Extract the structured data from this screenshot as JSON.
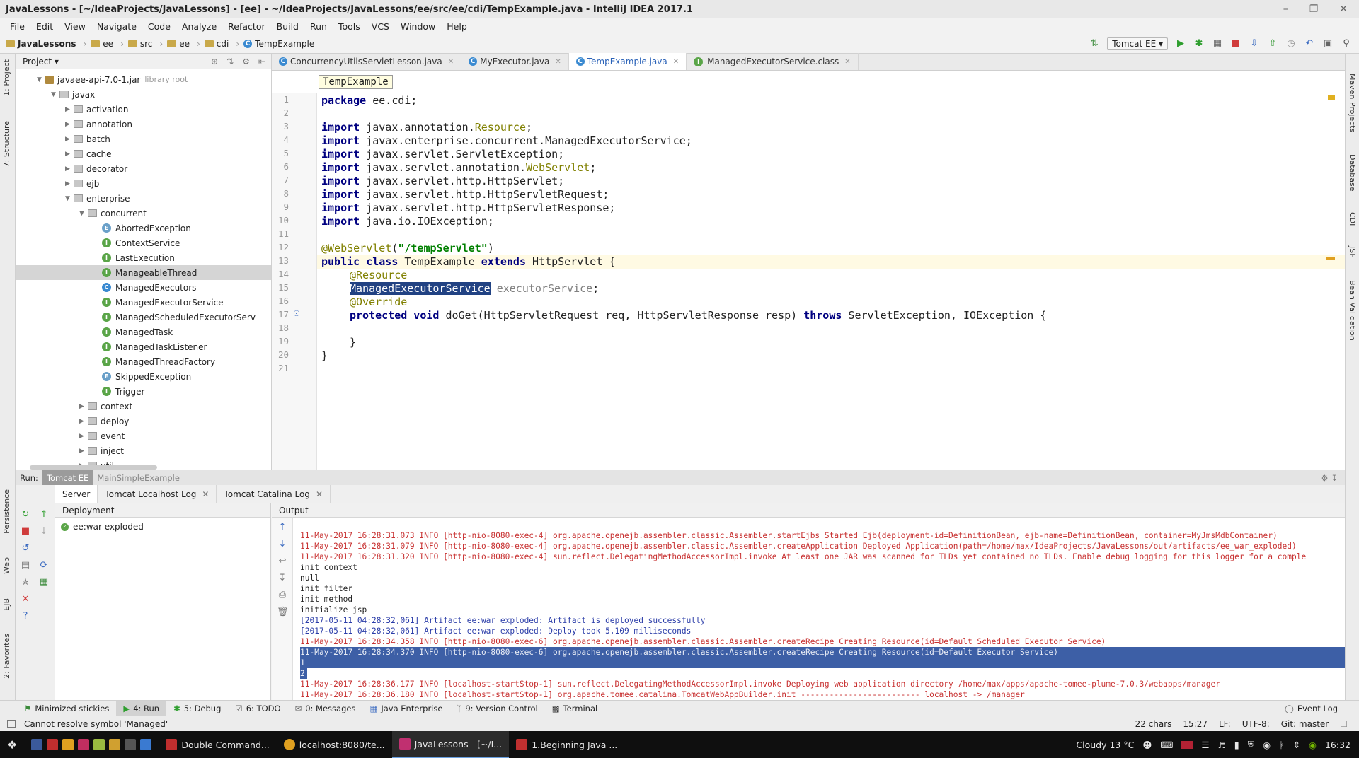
{
  "window": {
    "title": "JavaLessons - [~/IdeaProjects/JavaLessons] - [ee] - ~/IdeaProjects/JavaLessons/ee/src/ee/cdi/TempExample.java - IntelliJ IDEA 2017.1"
  },
  "menu": [
    "File",
    "Edit",
    "View",
    "Navigate",
    "Code",
    "Analyze",
    "Refactor",
    "Build",
    "Run",
    "Tools",
    "VCS",
    "Window",
    "Help"
  ],
  "breadcrumb": [
    "JavaLessons",
    "ee",
    "src",
    "ee",
    "cdi",
    "TempExample"
  ],
  "run_config": "Tomcat EE",
  "project_panel": {
    "title": "Project",
    "tree": [
      {
        "label": "javaee-api-7.0-1.jar",
        "note": "library root",
        "kind": "jar"
      },
      {
        "label": "javax",
        "kind": "pkg"
      },
      {
        "label": "activation",
        "kind": "pkg"
      },
      {
        "label": "annotation",
        "kind": "pkg"
      },
      {
        "label": "batch",
        "kind": "pkg"
      },
      {
        "label": "cache",
        "kind": "pkg"
      },
      {
        "label": "decorator",
        "kind": "pkg"
      },
      {
        "label": "ejb",
        "kind": "pkg"
      },
      {
        "label": "enterprise",
        "kind": "pkg"
      },
      {
        "label": "concurrent",
        "kind": "pkg"
      },
      {
        "label": "AbortedException",
        "kind": "ex"
      },
      {
        "label": "ContextService",
        "kind": "iface"
      },
      {
        "label": "LastExecution",
        "kind": "iface"
      },
      {
        "label": "ManageableThread",
        "kind": "iface"
      },
      {
        "label": "ManagedExecutors",
        "kind": "class"
      },
      {
        "label": "ManagedExecutorService",
        "kind": "iface"
      },
      {
        "label": "ManagedScheduledExecutorServ",
        "kind": "iface"
      },
      {
        "label": "ManagedTask",
        "kind": "iface"
      },
      {
        "label": "ManagedTaskListener",
        "kind": "iface"
      },
      {
        "label": "ManagedThreadFactory",
        "kind": "iface"
      },
      {
        "label": "SkippedException",
        "kind": "ex"
      },
      {
        "label": "Trigger",
        "kind": "iface"
      },
      {
        "label": "context",
        "kind": "pkg"
      },
      {
        "label": "deploy",
        "kind": "pkg"
      },
      {
        "label": "event",
        "kind": "pkg"
      },
      {
        "label": "inject",
        "kind": "pkg"
      },
      {
        "label": "util",
        "kind": "pkg"
      }
    ]
  },
  "editor": {
    "tabs": [
      {
        "label": "ConcurrencyUtilsServletLesson.java",
        "active": false
      },
      {
        "label": "MyExecutor.java",
        "active": false
      },
      {
        "label": "TempExample.java",
        "active": true
      },
      {
        "label": "ManagedExecutorService.class",
        "active": false
      }
    ],
    "crumb_popup": "TempExample",
    "line_numbers": [
      "1",
      "2",
      "3",
      "4",
      "5",
      "6",
      "7",
      "8",
      "9",
      "10",
      "11",
      "12",
      "13",
      "14",
      "15",
      "16",
      "17",
      "18",
      "19",
      "20",
      "21"
    ],
    "code": {
      "l1_kw": "package",
      "l1_rest": " ee.cdi;",
      "imp": "import",
      "l3a": " javax.annotation.",
      "l3b": "Resource",
      "l3c": ";",
      "l4": " javax.enterprise.concurrent.ManagedExecutorService;",
      "l5": " javax.servlet.ServletException;",
      "l6a": " javax.servlet.annotation.",
      "l6b": "WebServlet",
      "l6c": ";",
      "l7": " javax.servlet.http.HttpServlet;",
      "l8": " javax.servlet.http.HttpServletRequest;",
      "l9": " javax.servlet.http.HttpServletResponse;",
      "l10": " java.io.IOException;",
      "l12a": "@WebServlet",
      "l12b": "(",
      "l12c": "\"/tempServlet\"",
      "l12d": ")",
      "l13a": "public class",
      "l13b": " TempExample ",
      "l13c": "extends",
      "l13d": " HttpServlet {",
      "l14": "@Resource",
      "l15a": "ManagedExecutorService",
      "l15b": " executorService",
      "l15c": ";",
      "l16": "@Override",
      "l17a": "protected void",
      "l17b": " doGet(HttpServletRequest req, HttpServletResponse resp) ",
      "l17c": "throws",
      "l17d": " ServletException, IOException {",
      "l19": "}",
      "l20": "}"
    }
  },
  "run_panel": {
    "label": "Run:",
    "configs": [
      "Tomcat EE",
      "MainSimpleExample"
    ],
    "subtabs": [
      "Server",
      "Tomcat Localhost Log",
      "Tomcat Catalina Log"
    ],
    "deployment_header": "Deployment",
    "deployment_item": "ee:war exploded",
    "output_header": "Output",
    "log": [
      "11-May-2017 16:28:31.073 INFO [http-nio-8080-exec-4] org.apache.openejb.assembler.classic.Assembler.startEjbs Started Ejb(deployment-id=DefinitionBean, ejb-name=DefinitionBean, container=MyJmsMdbContainer)",
      "11-May-2017 16:28:31.079 INFO [http-nio-8080-exec-4] org.apache.openejb.assembler.classic.Assembler.createApplication Deployed Application(path=/home/max/IdeaProjects/JavaLessons/out/artifacts/ee_war_exploded)",
      "11-May-2017 16:28:31.320 INFO [http-nio-8080-exec-4] sun.reflect.DelegatingMethodAccessorImpl.invoke At least one JAR was scanned for TLDs yet contained no TLDs. Enable debug logging for this logger for a comple",
      "init context",
      "null",
      "init filter",
      "init method",
      "initialize jsp",
      "[2017-05-11 04:28:32,061] Artifact ee:war exploded: Artifact is deployed successfully",
      "[2017-05-11 04:28:32,061] Artifact ee:war exploded: Deploy took 5,109 milliseconds",
      "11-May-2017 16:28:34.358 INFO [http-nio-8080-exec-6] org.apache.openejb.assembler.classic.Assembler.createRecipe Creating Resource(id=Default Scheduled Executor Service)",
      "11-May-2017 16:28:34.370 INFO [http-nio-8080-exec-6] org.apache.openejb.assembler.classic.Assembler.createRecipe Creating Resource(id=Default Executor Service)",
      "1",
      "2",
      "11-May-2017 16:28:36.177 INFO [localhost-startStop-1] sun.reflect.DelegatingMethodAccessorImpl.invoke Deploying web application directory /home/max/apps/apache-tomee-plume-7.0.3/webapps/manager",
      "11-May-2017 16:28:36.180 INFO [localhost-startStop-1] org.apache.tomee.catalina.TomcatWebAppBuilder.init ------------------------- localhost -> /manager"
    ]
  },
  "left_strip": [
    "1: Project",
    "7: Structure",
    "Persistence",
    "Web",
    "EJB",
    "2: Favorites"
  ],
  "right_strip": [
    "Maven Projects",
    "Database",
    "CDI",
    "JSF",
    "Bean Validation"
  ],
  "bottom_tools": [
    "Minimized stickies",
    "4: Run",
    "5: Debug",
    "6: TODO",
    "0: Messages",
    "Java Enterprise",
    "9: Version Control",
    "Terminal",
    "Event Log"
  ],
  "status": {
    "message": "Cannot resolve symbol 'Managed'",
    "chars": "22 chars",
    "pos": "15:27",
    "lf": "LF:",
    "enc": "UTF-8:",
    "git": "Git: master"
  },
  "taskbar": {
    "items": [
      "Double Command...",
      "localhost:8080/te...",
      "JavaLessons - [~/I...",
      "1.Beginning Java ..."
    ],
    "weather": "Cloudy 13 °C",
    "time": "16:32"
  }
}
